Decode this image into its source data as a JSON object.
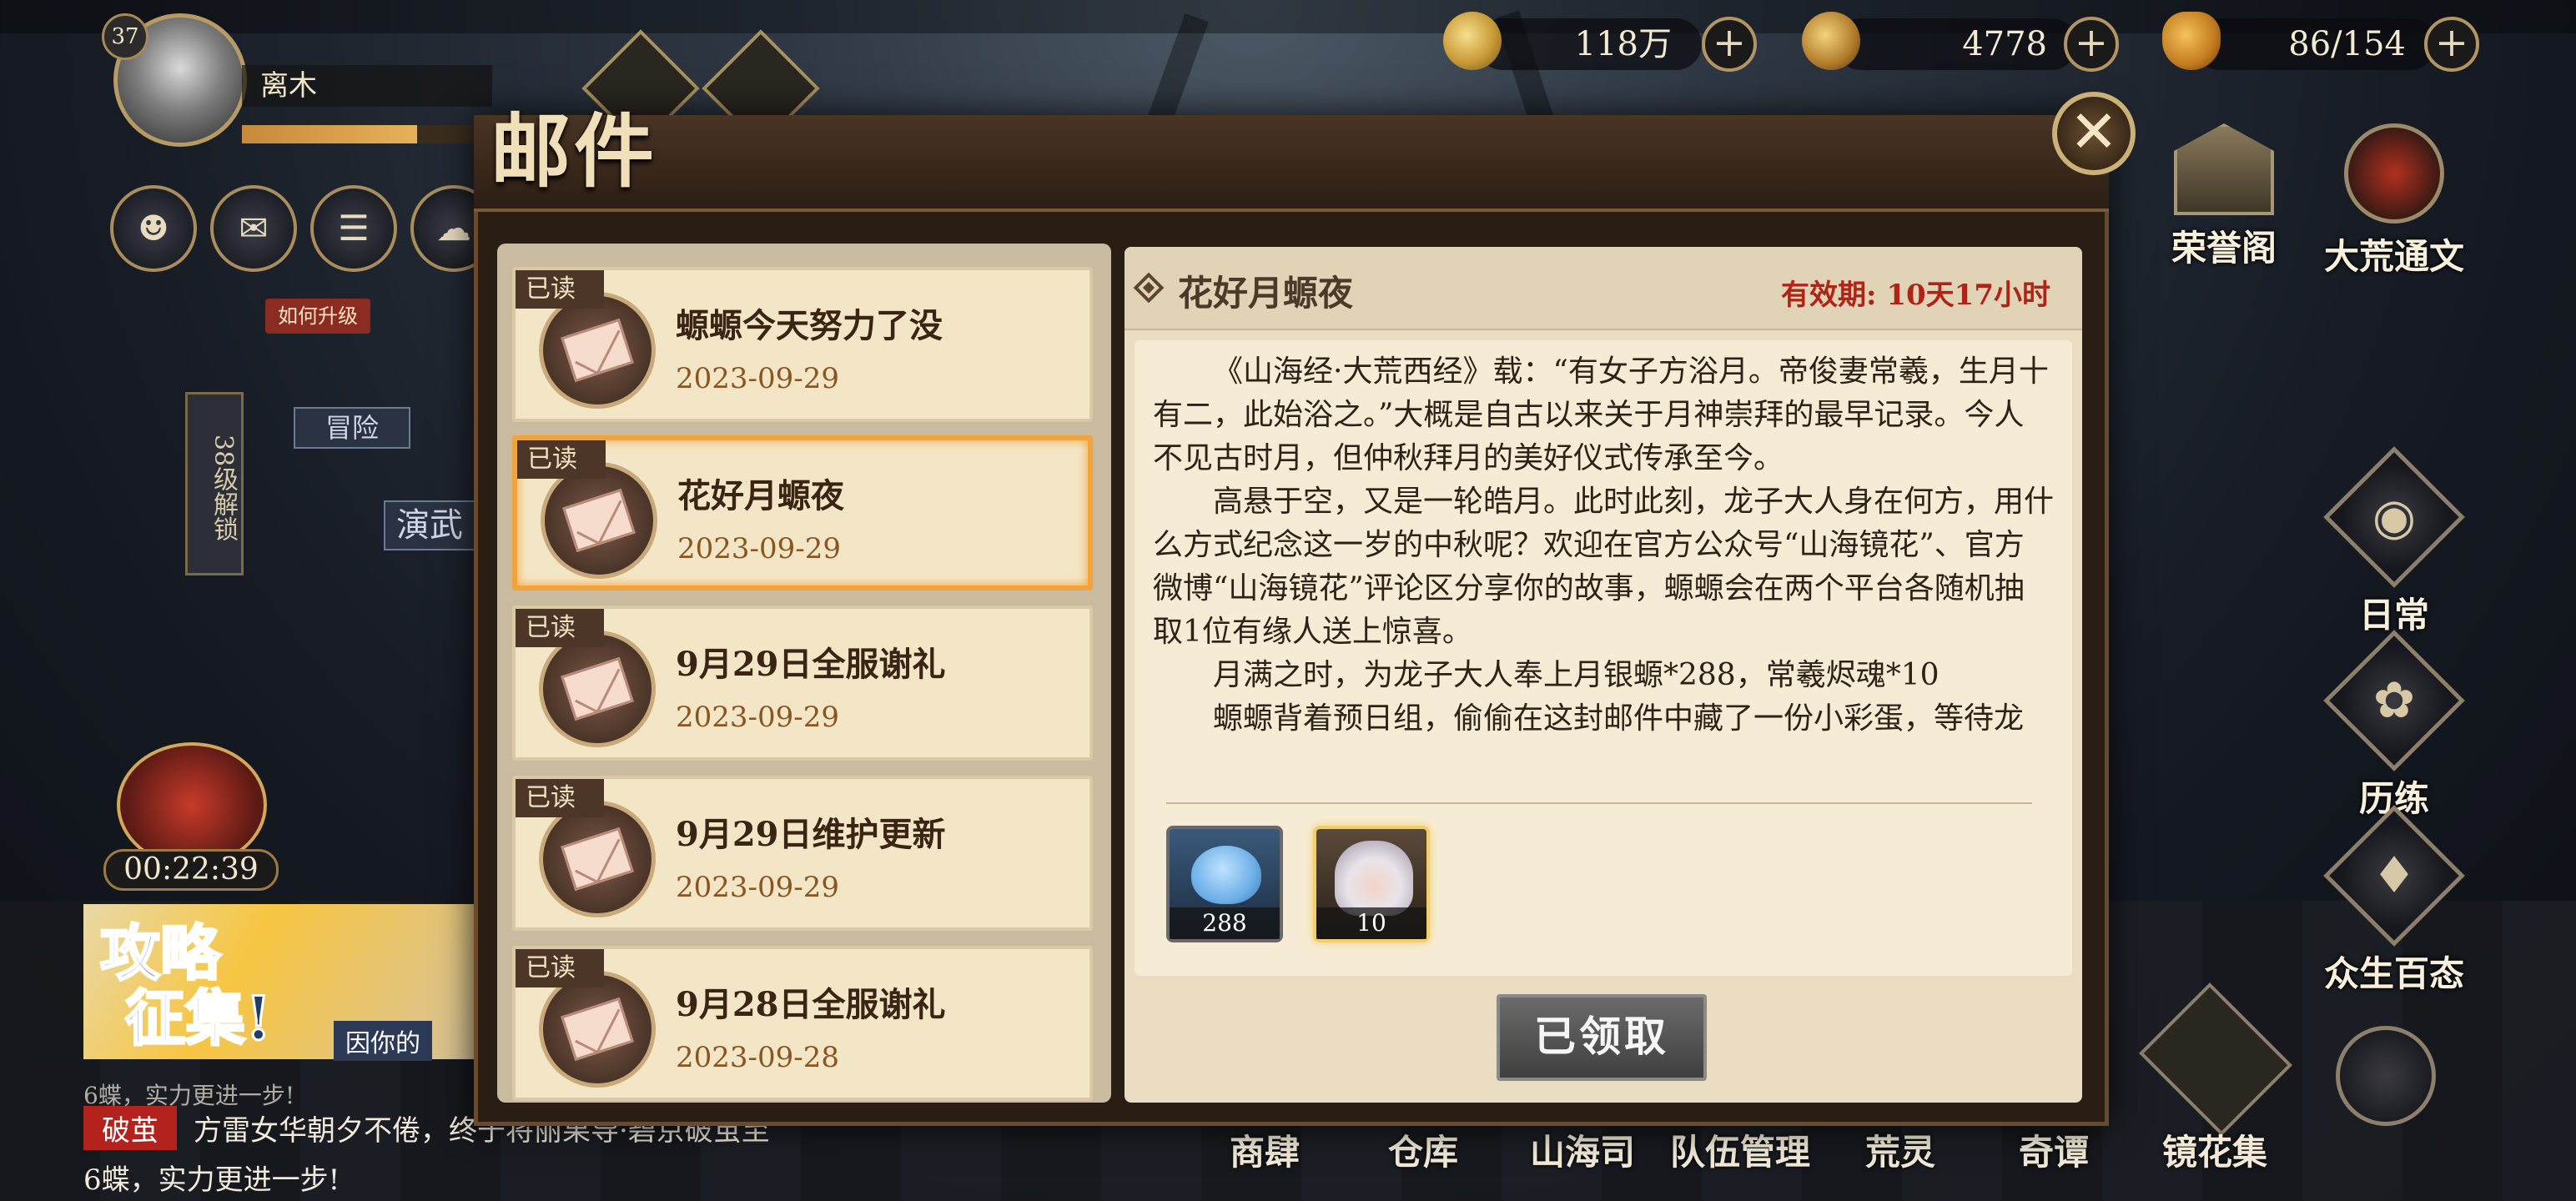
{
  "player": {
    "level": "37",
    "name": "离木",
    "xp_fraction": 0.7
  },
  "currencies": [
    {
      "icon": "coin-icon",
      "value": "118万"
    },
    {
      "icon": "jade-icon",
      "value": "4778"
    },
    {
      "icon": "stamina-gourd-icon",
      "value": "86/154"
    }
  ],
  "left": {
    "upgrade_tag": "如何升级",
    "lock_text": "38级解锁",
    "adventure": "冒险",
    "performance": "演武",
    "timer": "00:22:39",
    "banner": {
      "line1": "攻略",
      "line2": "征集!",
      "sub": "因你的"
    },
    "ticker": {
      "line0": "6蝶，实力更进一步!",
      "tag": "破茧",
      "line1": "方雷女华朝夕不倦，终于将丽果导·碧京破茧至",
      "line2": "6蝶，实力更进一步!"
    }
  },
  "side_menu": [
    {
      "label": "荣誉阁",
      "icon": "honor-hall-icon"
    },
    {
      "label": "大荒通文",
      "icon": "dahuang-emblem-icon"
    },
    {
      "label": "日常",
      "icon": "daily-eye-icon"
    },
    {
      "label": "历练",
      "icon": "training-icon"
    },
    {
      "label": "众生百态",
      "icon": "cards-icon"
    }
  ],
  "bottom_nav": [
    "商肆",
    "仓库",
    "山海司",
    "队伍管理",
    "荒灵",
    "奇谭",
    "镜花集"
  ],
  "mail": {
    "title": "邮件",
    "read_label": "已读",
    "items": [
      {
        "title": "螈螈今天努力了没",
        "date": "2023-09-29"
      },
      {
        "title": "花好月螈夜",
        "date": "2023-09-29"
      },
      {
        "title": "9月29日全服谢礼",
        "date": "2023-09-29"
      },
      {
        "title": "9月29日维护更新",
        "date": "2023-09-29"
      },
      {
        "title": "9月28日全服谢礼",
        "date": "2023-09-28"
      }
    ],
    "selected": {
      "title": "花好月螈夜",
      "validity_label": "有效期:",
      "validity_value": "10天17小时",
      "paragraphs": [
        "《山海经·大荒西经》载：“有女子方浴月。帝俊妻常羲，生月十有二，此始浴之。”大概是自古以来关于月神崇拜的最早记录。今人不见古时月，但仲秋拜月的美好仪式传承至今。",
        "高悬于空，又是一轮皓月。此时此刻，龙子大人身在何方，用什么方式纪念这一岁的中秋呢？欢迎在官方公众号“山海镜花”、官方微博“山海镜花”评论区分享你的故事，螈螈会在两个平台各随机抽取1位有缘人送上惊喜。",
        "月满之时，为龙子大人奉上月银螈*288，常羲烬魂*10",
        "螈螈背着预日组，偷偷在这封邮件中藏了一份小彩蛋，等待龙"
      ],
      "rewards": [
        {
          "name": "月银螈",
          "qty": "288",
          "icon": "blue-creature-icon"
        },
        {
          "name": "常羲烬魂",
          "qty": "10",
          "icon": "changxi-portrait-icon"
        }
      ],
      "claim_label": "已领取"
    }
  }
}
